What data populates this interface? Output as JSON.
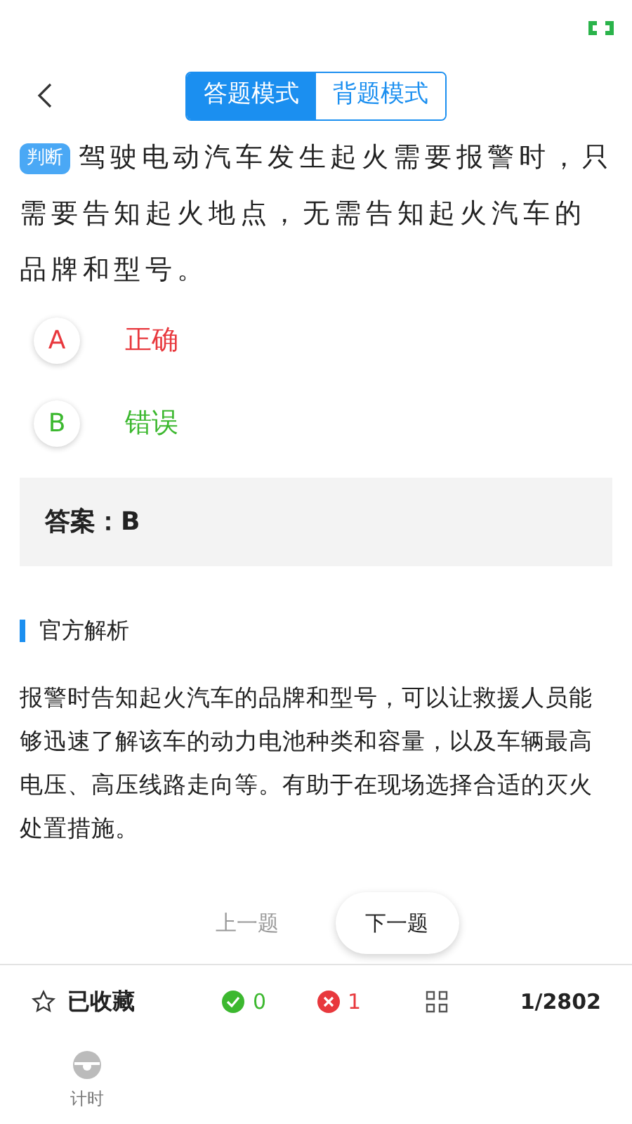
{
  "header": {
    "modes": [
      {
        "label": "答题模式",
        "selected": true
      },
      {
        "label": "背题模式",
        "selected": false
      }
    ]
  },
  "question": {
    "tag": "判断",
    "text": "驾驶电动汽车发生起火需要报警时，只需要告知起火地点，无需告知起火汽车的品牌和型号。"
  },
  "options": [
    {
      "letter": "A",
      "text": "正确",
      "correct": false
    },
    {
      "letter": "B",
      "text": "错误",
      "correct": true
    }
  ],
  "answer": {
    "label": "答案：",
    "value": "B"
  },
  "analysis": {
    "title": "官方解析",
    "text": "报警时告知起火汽车的品牌和型号，可以让救援人员能够迅速了解该车的动力电池种类和容量，以及车辆最高电压、高压线路走向等。有助于在现场选择合适的灭火处置措施。"
  },
  "nav": {
    "prev": "上一题",
    "next": "下一题"
  },
  "footer": {
    "favorite": "已收藏",
    "correct_count": "0",
    "wrong_count": "1",
    "progress": "1/2802"
  },
  "tabs": [
    {
      "label": "计时"
    }
  ]
}
